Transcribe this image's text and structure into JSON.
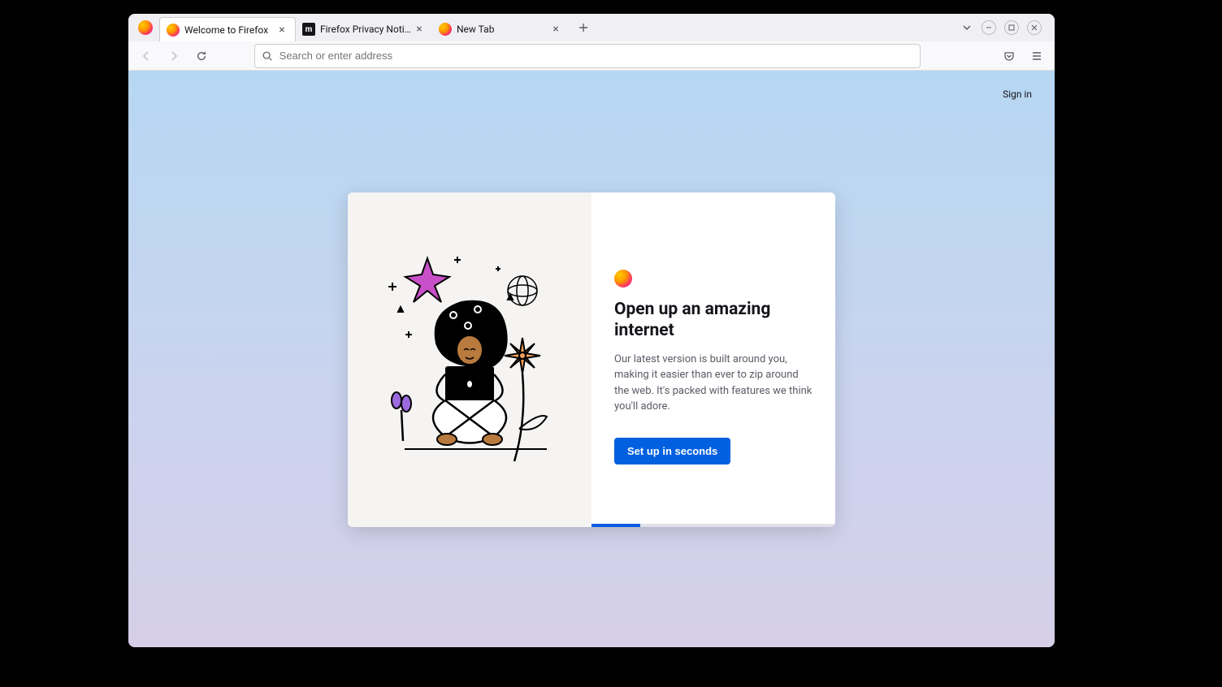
{
  "tabs": [
    {
      "label": "Welcome to Firefox",
      "favicon": "ff"
    },
    {
      "label": "Firefox Privacy Notice —",
      "favicon": "m"
    },
    {
      "label": "New Tab",
      "favicon": "ff"
    }
  ],
  "address_bar": {
    "placeholder": "Search or enter address"
  },
  "sign_in_label": "Sign in",
  "welcome": {
    "headline": "Open up an amazing internet",
    "body": "Our latest version is built around you, making it easier than ever to zip around the web. It's packed with features we think you'll adore.",
    "cta": "Set up in seconds"
  }
}
